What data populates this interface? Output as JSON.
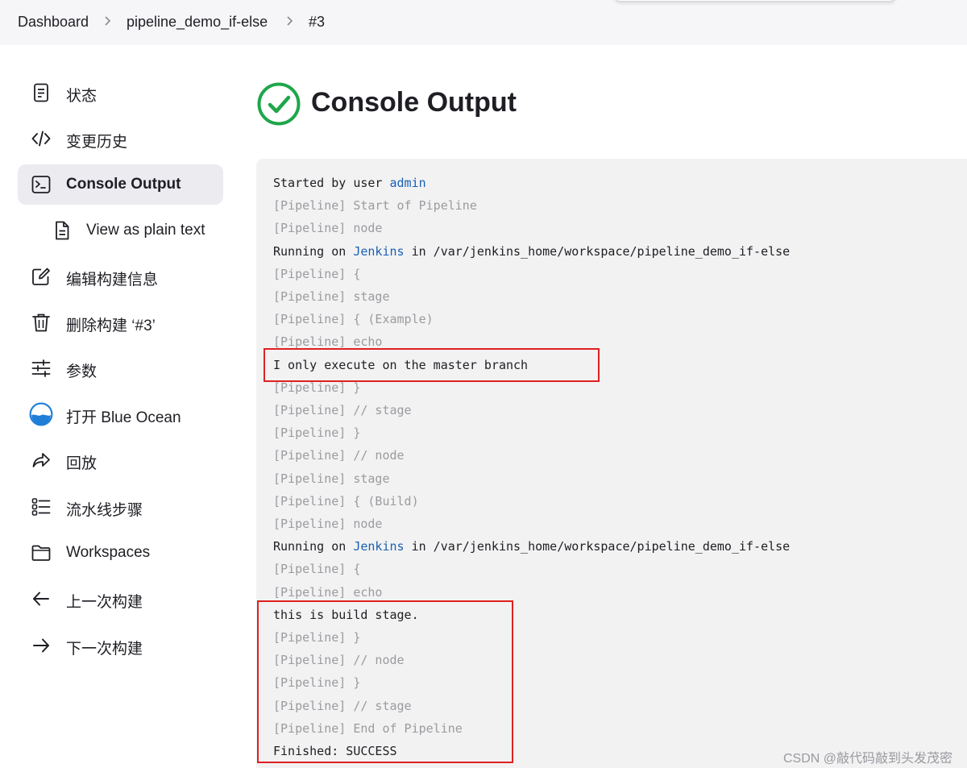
{
  "breadcrumb": {
    "items": [
      "Dashboard",
      "pipeline_demo_if-else",
      "#3"
    ],
    "separator": ">"
  },
  "sidebar": {
    "items": [
      {
        "label": "状态",
        "icon": "document-icon"
      },
      {
        "label": "变更历史",
        "icon": "code-icon"
      },
      {
        "label": "Console Output",
        "icon": "terminal-icon",
        "active": true
      },
      {
        "label": "View as plain text",
        "icon": "file-text-icon"
      },
      {
        "label": "编辑构建信息",
        "icon": "edit-icon"
      },
      {
        "label": "删除构建 ‘#3’",
        "icon": "trash-icon"
      },
      {
        "label": "参数",
        "icon": "sliders-icon"
      },
      {
        "label": "打开 Blue Ocean",
        "icon": "blue-ocean-icon"
      },
      {
        "label": "回放",
        "icon": "replay-icon"
      },
      {
        "label": "流水线步骤",
        "icon": "list-icon"
      },
      {
        "label": "Workspaces",
        "icon": "folder-icon"
      },
      {
        "label": "上一次构建",
        "icon": "arrow-left-icon"
      },
      {
        "label": "下一次构建",
        "icon": "arrow-right-icon"
      }
    ]
  },
  "main": {
    "title": "Console Output",
    "status_icon": "success-check-icon",
    "status_color": "#1ea64b"
  },
  "console": {
    "lines": [
      {
        "prefix": "Started by user ",
        "link": "admin",
        "suffix": "",
        "dim": false
      },
      {
        "prefix": "[Pipeline] Start of Pipeline",
        "link": "",
        "suffix": "",
        "dim": true
      },
      {
        "prefix": "[Pipeline] node",
        "link": "",
        "suffix": "",
        "dim": true
      },
      {
        "prefix": "Running on ",
        "link": "Jenkins",
        "suffix": " in /var/jenkins_home/workspace/pipeline_demo_if-else",
        "dim": false
      },
      {
        "prefix": "[Pipeline] {",
        "link": "",
        "suffix": "",
        "dim": true
      },
      {
        "prefix": "[Pipeline] stage",
        "link": "",
        "suffix": "",
        "dim": true
      },
      {
        "prefix": "[Pipeline] { (Example)",
        "link": "",
        "suffix": "",
        "dim": true
      },
      {
        "prefix": "[Pipeline] echo",
        "link": "",
        "suffix": "",
        "dim": true
      },
      {
        "prefix": "I only execute on the master branch",
        "link": "",
        "suffix": "",
        "dim": false
      },
      {
        "prefix": "[Pipeline] }",
        "link": "",
        "suffix": "",
        "dim": true
      },
      {
        "prefix": "[Pipeline] // stage",
        "link": "",
        "suffix": "",
        "dim": true
      },
      {
        "prefix": "[Pipeline] }",
        "link": "",
        "suffix": "",
        "dim": true
      },
      {
        "prefix": "[Pipeline] // node",
        "link": "",
        "suffix": "",
        "dim": true
      },
      {
        "prefix": "[Pipeline] stage",
        "link": "",
        "suffix": "",
        "dim": true
      },
      {
        "prefix": "[Pipeline] { (Build)",
        "link": "",
        "suffix": "",
        "dim": true
      },
      {
        "prefix": "[Pipeline] node",
        "link": "",
        "suffix": "",
        "dim": true
      },
      {
        "prefix": "Running on ",
        "link": "Jenkins",
        "suffix": " in /var/jenkins_home/workspace/pipeline_demo_if-else",
        "dim": false
      },
      {
        "prefix": "[Pipeline] {",
        "link": "",
        "suffix": "",
        "dim": true
      },
      {
        "prefix": "[Pipeline] echo",
        "link": "",
        "suffix": "",
        "dim": true
      },
      {
        "prefix": "this is build stage.",
        "link": "",
        "suffix": "",
        "dim": false
      },
      {
        "prefix": "[Pipeline] }",
        "link": "",
        "suffix": "",
        "dim": true
      },
      {
        "prefix": "[Pipeline] // node",
        "link": "",
        "suffix": "",
        "dim": true
      },
      {
        "prefix": "[Pipeline] }",
        "link": "",
        "suffix": "",
        "dim": true
      },
      {
        "prefix": "[Pipeline] // stage",
        "link": "",
        "suffix": "",
        "dim": true
      },
      {
        "prefix": "[Pipeline] End of Pipeline",
        "link": "",
        "suffix": "",
        "dim": true
      },
      {
        "prefix": "Finished: SUCCESS",
        "link": "",
        "suffix": "",
        "dim": false
      }
    ],
    "link_color": "#1a5fb4",
    "highlight_color": "#e02020"
  },
  "watermark": "CSDN @敲代码敲到头发茂密"
}
